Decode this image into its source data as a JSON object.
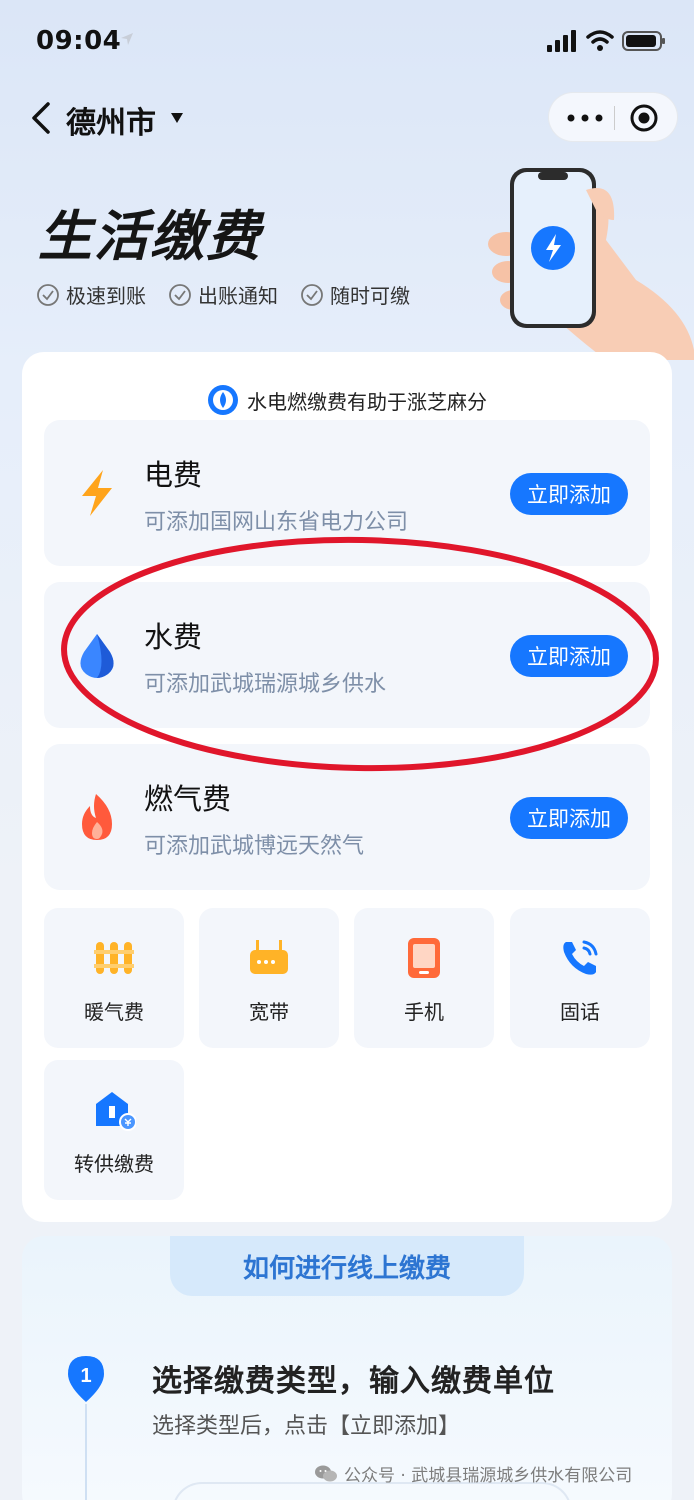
{
  "status_bar": {
    "time": "09:04"
  },
  "nav": {
    "city": "德州市"
  },
  "hero": {
    "title": "生活缴费",
    "features": [
      "极速到账",
      "出账通知",
      "随时可缴"
    ]
  },
  "main": {
    "sesame_tip": "水电燃缴费有助于涨芝麻分",
    "bills": [
      {
        "name": "电费",
        "desc": "可添加国网山东省电力公司",
        "button": "立即添加",
        "icon": "lightning-icon",
        "color": "#ffa41b"
      },
      {
        "name": "水费",
        "desc": "可添加武城瑞源城乡供水",
        "button": "立即添加",
        "icon": "water-drop-icon",
        "color": "#1677ff"
      },
      {
        "name": "燃气费",
        "desc": "可添加武城博远天然气",
        "button": "立即添加",
        "icon": "flame-icon",
        "color": "#ff5a3c"
      }
    ],
    "grid": [
      {
        "label": "暖气费",
        "icon": "radiator-icon"
      },
      {
        "label": "宽带",
        "icon": "router-icon"
      },
      {
        "label": "手机",
        "icon": "mobile-phone-icon"
      },
      {
        "label": "固话",
        "icon": "telephone-icon"
      },
      {
        "label": "转供缴费",
        "icon": "transfer-payment-icon"
      }
    ]
  },
  "howto": {
    "title": "如何进行线上缴费",
    "step_number": "1",
    "step_title": "选择缴费类型，输入缴费单位",
    "step_sub": "选择类型后，点击【立即添加】"
  },
  "watermark": "公众号 · 武城县瑞源城乡供水有限公司",
  "colors": {
    "accent": "#1677ff",
    "annotation": "#e0162b"
  }
}
